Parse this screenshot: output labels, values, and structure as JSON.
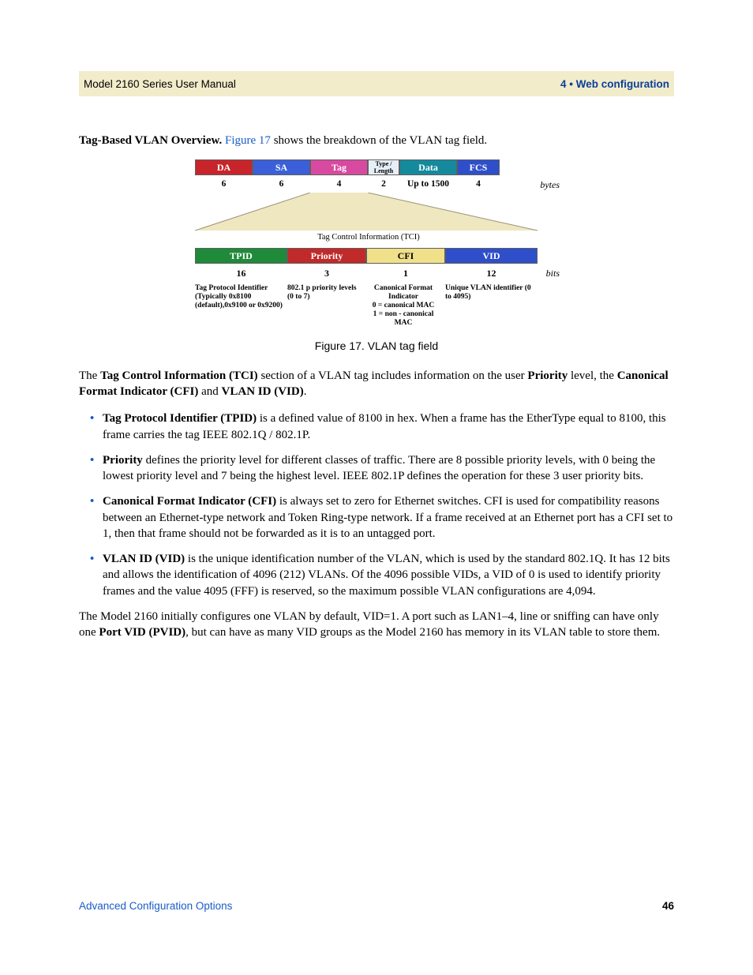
{
  "header": {
    "left": "Model 2160 Series User Manual",
    "right": "4 • Web configuration"
  },
  "intro": {
    "lead": "Tag-Based VLAN Overview. ",
    "figref": "Figure 17",
    "tail": " shows the breakdown of the VLAN tag field."
  },
  "figure": {
    "caption": "Figure 17. VLAN tag field",
    "row1": {
      "da": "DA",
      "sa": "SA",
      "tag": "Tag",
      "tl": "Type / Length",
      "data": "Data",
      "fcs": "FCS",
      "bytes_label": "bytes",
      "sizes": {
        "da": "6",
        "sa": "6",
        "tag": "4",
        "tl": "2",
        "data": "Up to 1500",
        "fcs": "4"
      }
    },
    "tci_label": "Tag Control Information (TCI)",
    "row2": {
      "tpid": "TPID",
      "prio": "Priority",
      "cfi": "CFI",
      "vid": "VID",
      "bits_label": "bits",
      "sizes": {
        "tpid": "16",
        "prio": "3",
        "cfi": "1",
        "vid": "12"
      }
    },
    "desc": {
      "tpid": "Tag Protocol Identifier (Typically 0x8100 (default),0x9100 or 0x9200)",
      "prio": "802.1 p priority levels (0 to 7)",
      "cfi": "Canonical Format Indicator\n0 = canonical MAC\n1 = non - canonical MAC",
      "vid": "Unique VLAN identifier (0 to 4095)"
    }
  },
  "p_tci": {
    "pre": "The ",
    "b1": "Tag Control Information (TCI)",
    "mid1": " section of a VLAN tag includes information on the user ",
    "b2": "Priority",
    "mid2": " level, the ",
    "b3": "Canonical Format Indicator (CFI)",
    "mid3": " and ",
    "b4": "VLAN ID (VID)",
    "post": "."
  },
  "bullets": {
    "tpid": {
      "b": "Tag Protocol Identifier (TPID)",
      "t": " is a defined value of 8100 in hex. When a frame has the EtherType equal to 8100, this frame carries the tag IEEE 802.1Q / 802.1P."
    },
    "prio": {
      "b": "Priority",
      "t": " defines the priority level for different classes of traffic. There are 8 possible priority levels, with 0 being the lowest priority level and 7 being the highest level. IEEE 802.1P defines the operation for these 3 user priority bits."
    },
    "cfi": {
      "b": "Canonical Format Indicator (CFI)",
      "t": " is always set to zero for Ethernet switches. CFI is used for compatibility reasons between an Ethernet-type network and Token Ring-type network. If a frame received at an Ethernet port has a CFI set to 1, then that frame should not be forwarded as it is to an untagged port."
    },
    "vid": {
      "b": "VLAN ID (VID)",
      "t": " is the unique identification number of the VLAN, which is used by the standard 802.1Q. It has 12 bits and allows the identification of 4096 (212) VLANs. Of the 4096 possible VIDs, a VID of 0 is used to identify priority frames and the value 4095 (FFF) is reserved, so the maximum possible VLAN configurations are 4,094."
    }
  },
  "p_final": {
    "pre": "The Model 2160 initially configures one VLAN by default, VID=1. A port such as LAN1–4, line or sniffing can have only one ",
    "b": "Port VID (PVID)",
    "post": ", but can have as many VID groups as the Model 2160 has memory in its VLAN table to store them."
  },
  "footer": {
    "left": "Advanced Configuration Options",
    "right": "46"
  }
}
